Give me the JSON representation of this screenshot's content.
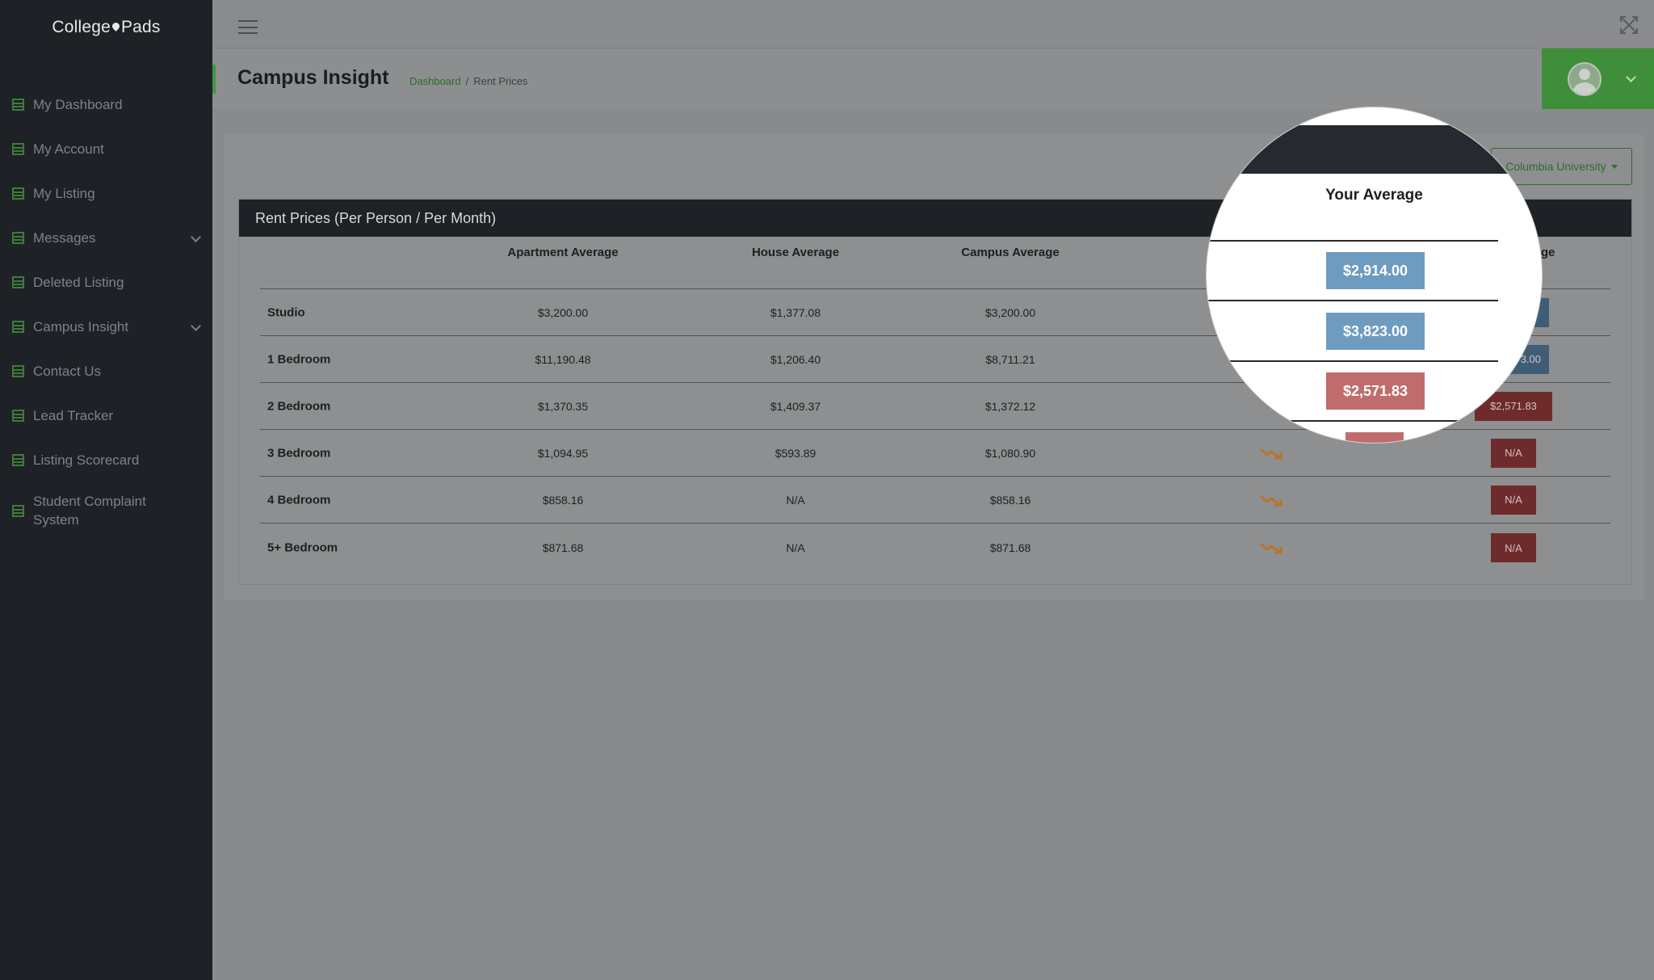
{
  "app": {
    "logo_left": "College",
    "logo_right": "Pads"
  },
  "sidebar": {
    "items": [
      {
        "label": "My Dashboard"
      },
      {
        "label": "My Account"
      },
      {
        "label": "My Listing"
      },
      {
        "label": "Messages"
      },
      {
        "label": "Deleted Listing"
      },
      {
        "label": "Campus Insight"
      },
      {
        "label": "Contact Us"
      },
      {
        "label": "Lead Tracker"
      },
      {
        "label": "Listing Scorecard"
      },
      {
        "label": "Student Complaint System"
      }
    ]
  },
  "header": {
    "title": "Campus Insight",
    "breadcrumb": {
      "home": "Dashboard",
      "separator": "/",
      "current": "Rent Prices"
    }
  },
  "filter": {
    "university": "Columbia University"
  },
  "table": {
    "title": "Rent Prices (Per Person / Per Month)",
    "columns": [
      "Apartment Average",
      "House Average",
      "Campus Average",
      "ge"
    ],
    "rows": [
      {
        "label": "Studio",
        "apartment": "$3,200.00",
        "house": "$1,377.08",
        "campus": "$3,200.00",
        "yours": ""
      },
      {
        "label": "1 Bedroom",
        "apartment": "$11,190.48",
        "house": "$1,206.40",
        "campus": "$8,711.21",
        "yours": "3.00"
      },
      {
        "label": "2 Bedroom",
        "apartment": "$1,370.35",
        "house": "$1,409.37",
        "campus": "$1,372.12",
        "yours": "$2,571.83"
      },
      {
        "label": "3 Bedroom",
        "apartment": "$1,094.95",
        "house": "$593.89",
        "campus": "$1,080.90",
        "yours": "N/A"
      },
      {
        "label": "4 Bedroom",
        "apartment": "$858.16",
        "house": "N/A",
        "campus": "$858.16",
        "yours": "N/A"
      },
      {
        "label": "5+ Bedroom",
        "apartment": "$871.68",
        "house": "N/A",
        "campus": "$871.68",
        "yours": "N/A"
      }
    ]
  },
  "magnifier": {
    "title": "Your Average",
    "values": [
      "$2,914.00",
      "$3,823.00",
      "$2,571.83"
    ]
  },
  "colors": {
    "accent_green": "#3f8f3a",
    "pill_blue": "#6e9bc0",
    "pill_red": "#c06c6c",
    "trend_orange": "#b8742a",
    "sidebar_bg": "#1e2226"
  },
  "icons": {
    "menu": "hamburger-icon",
    "fullscreen": "expand-icon",
    "nav": "list-icon",
    "trend": "trend-down-icon",
    "user": "avatar-icon"
  }
}
